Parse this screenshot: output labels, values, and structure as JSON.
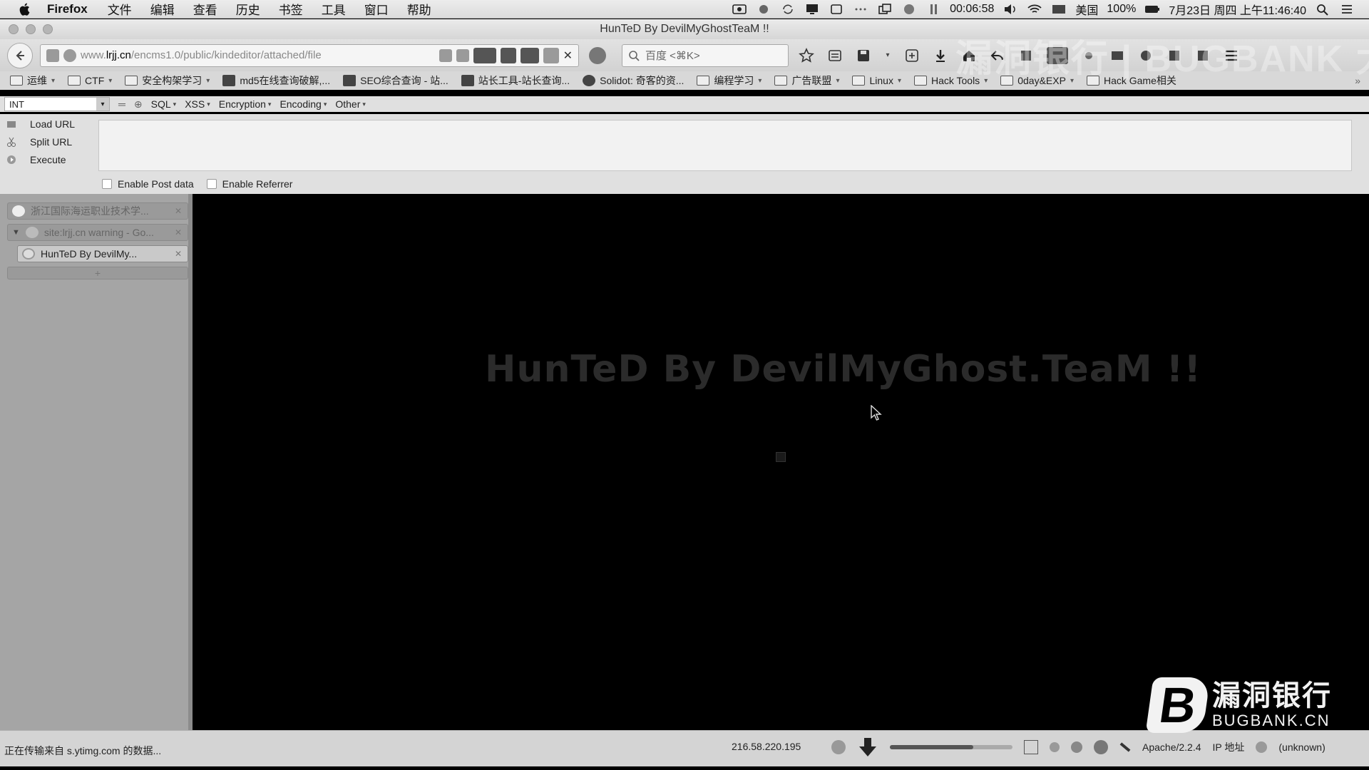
{
  "menubar": {
    "app": "Firefox",
    "items": [
      "文件",
      "编辑",
      "查看",
      "历史",
      "书签",
      "工具",
      "窗口",
      "帮助"
    ],
    "timer": "00:06:58",
    "input_method": "美国",
    "battery": "100%",
    "datetime": "7月23日 周四 上午11:46:40"
  },
  "window": {
    "title": "HunTeD By DevilMyGhostTeaM !!"
  },
  "navbar": {
    "url_prefix": "www.",
    "url_domain": "lrjj.cn",
    "url_path": "/encms1.0/public/kindeditor/attached/file",
    "search_placeholder": "百度 <⌘K>"
  },
  "bookmarks": [
    {
      "label": "运维",
      "type": "folder",
      "menu": true
    },
    {
      "label": "CTF",
      "type": "folder",
      "menu": true
    },
    {
      "label": "安全构架学习",
      "type": "folder",
      "menu": true
    },
    {
      "label": "md5在线查询破解,...",
      "type": "site"
    },
    {
      "label": "SEO综合查询 - 站...",
      "type": "site"
    },
    {
      "label": "站长工具-站长查询...",
      "type": "site"
    },
    {
      "label": "Solidot: 奇客的资...",
      "type": "site-circle"
    },
    {
      "label": "编程学习",
      "type": "folder",
      "menu": true
    },
    {
      "label": "广告联盟",
      "type": "folder",
      "menu": true
    },
    {
      "label": "Linux",
      "type": "folder",
      "menu": true
    },
    {
      "label": "Hack Tools",
      "type": "folder",
      "menu": true
    },
    {
      "label": "0day&EXP",
      "type": "folder",
      "menu": true
    },
    {
      "label": "Hack Game相关",
      "type": "folder"
    }
  ],
  "bookmarks_more": "»",
  "hackbar": {
    "select_value": "INT",
    "menus": [
      "SQL",
      "XSS",
      "Encryption",
      "Encoding",
      "Other"
    ],
    "load_url": "Load URL",
    "split_url": "Split URL",
    "execute": "Execute",
    "enable_post": "Enable Post data",
    "enable_referrer": "Enable Referrer"
  },
  "sidebar": {
    "tabs": [
      {
        "label": "浙江国际海运职业技术学..."
      },
      {
        "label": "site:lrjj.cn warning - Go..."
      },
      {
        "label": "HunTeD By DevilMy..."
      }
    ],
    "add_label": "+"
  },
  "content": {
    "headline": "HunTeD By DevilMyGhost.TeaM !!"
  },
  "statusbar": {
    "transfer": "正在传输来自 s.ytimg.com 的数据...",
    "ip": "216.58.220.195",
    "volume_level": 0.68,
    "server": "Apache/2.2.4",
    "ip_label": "IP 地址",
    "unknown": "(unknown)"
  },
  "watermark": {
    "top_text": "漏洞银行 | BUGBANK 大咖面对面",
    "logo_letter": "B",
    "logo_cn": "漏洞银行",
    "logo_en": "BUGBANK.CN"
  },
  "colors": {
    "content_bg": "#000000",
    "headline": "#2b2b2b",
    "chrome": "#d8d8d8"
  }
}
